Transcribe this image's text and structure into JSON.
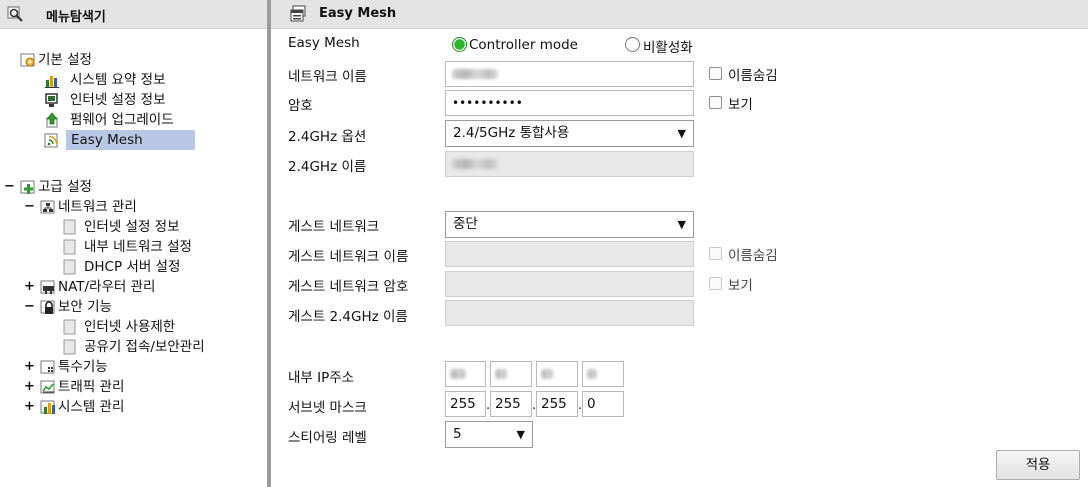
{
  "left_panel": {
    "title": "메뉴탐색기",
    "tree": {
      "basic": {
        "label": "기본 설정",
        "items": [
          "시스템 요약 정보",
          "인터넷 설정 정보",
          "펌웨어 업그레이드",
          "Easy Mesh"
        ],
        "selected": "Easy Mesh"
      },
      "advanced": {
        "label": "고급 설정",
        "network": {
          "label": "네트워크 관리",
          "items": [
            "인터넷 설정 정보",
            "내부 네트워크 설정",
            "DHCP 서버 설정"
          ]
        },
        "nat": {
          "label": "NAT/라우터 관리"
        },
        "security": {
          "label": "보안 기능",
          "items": [
            "인터넷 사용제한",
            "공유기 접속/보안관리"
          ]
        },
        "special": {
          "label": "특수기능"
        },
        "traffic": {
          "label": "트래픽 관리"
        },
        "system": {
          "label": "시스템 관리"
        }
      },
      "toggles": {
        "expanded": "−",
        "collapsed": "+"
      }
    }
  },
  "main": {
    "title": "Easy Mesh",
    "form": {
      "easymesh": {
        "label": "Easy Mesh",
        "option_controller": "Controller mode",
        "option_disable": "비활성화",
        "selected": "Controller mode"
      },
      "network_name": {
        "label": "네트워크 이름",
        "hide_label": "이름숨김"
      },
      "password": {
        "label": "암호",
        "value": "••••••••••",
        "show_label": "보기"
      },
      "band_option": {
        "label": "2.4GHz 옵션",
        "value": "2.4/5GHz 통합사용"
      },
      "band_name": {
        "label": "2.4GHz 이름"
      },
      "guest_network": {
        "label": "게스트 네트워크",
        "value": "중단"
      },
      "guest_name": {
        "label": "게스트 네트워크 이름",
        "hide_label": "이름숨김"
      },
      "guest_password": {
        "label": "게스트 네트워크 암호",
        "show_label": "보기"
      },
      "guest_band_name": {
        "label": "게스트 2.4GHz 이름"
      },
      "internal_ip": {
        "label": "내부 IP주소"
      },
      "subnet_mask": {
        "label": "서브넷 마스크",
        "octets": [
          "255",
          "255",
          "255",
          "0"
        ]
      },
      "steering_level": {
        "label": "스티어링 레벨",
        "value": "5"
      },
      "dot": "."
    },
    "apply_button": "적용",
    "colors": {
      "selected_bg": "#b8c8e4",
      "radio_on": "#2db52d",
      "header_bg": "#e4e4e4",
      "splitter": "#9c9c9c"
    }
  }
}
